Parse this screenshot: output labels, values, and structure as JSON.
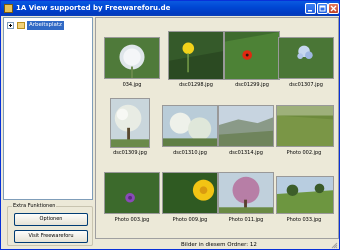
{
  "window": {
    "title": "1A View supported by Freewareforu.de",
    "accent": "#0054e3",
    "icon": "app-icon"
  },
  "title_buttons": {
    "minimize_icon": "minimize-icon",
    "maximize_icon": "maximize-icon",
    "close_icon": "close-icon"
  },
  "tree": {
    "root_label": "Arbeitsplatz",
    "expander_icon": "plus-expander-icon",
    "folder_icon": "folder-icon"
  },
  "extra": {
    "legend": "Extra Funktionen",
    "options_label": "Optionen",
    "visit_label": "Visit Freewareforu"
  },
  "thumbnails": [
    {
      "name": "034.jpg",
      "depicts": "dandelion seed head"
    },
    {
      "name": "dsc01298.jpg",
      "depicts": "yellow flower"
    },
    {
      "name": "dsc01299.jpg",
      "depicts": "red poppy"
    },
    {
      "name": "dsc01307.jpg",
      "depicts": "blue flowers"
    },
    {
      "name": "dsc01309.jpg",
      "depicts": "white blossoming tree"
    },
    {
      "name": "dsc01310.jpg",
      "depicts": "blossoms against sky"
    },
    {
      "name": "dsc01314.jpg",
      "depicts": "valley landscape"
    },
    {
      "name": "Photo 002.jpg",
      "depicts": "green meadow"
    },
    {
      "name": "Photo 003.jpg",
      "depicts": "purple flower"
    },
    {
      "name": "Photo 009.jpg",
      "depicts": "yellow flower"
    },
    {
      "name": "Photo 011.jpg",
      "depicts": "pink blossoming tree"
    },
    {
      "name": "Photo 033.jpg",
      "depicts": "green field and trees"
    }
  ],
  "status": {
    "count_label": "Bilder in diesem Ordner:",
    "count": "12"
  }
}
